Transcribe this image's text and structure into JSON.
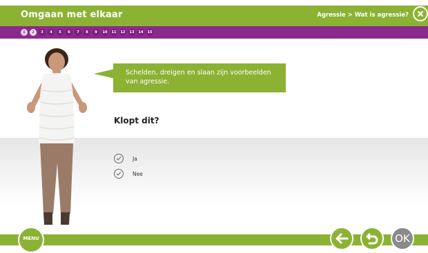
{
  "header": {
    "title": "Omgaan met elkaar",
    "breadcrumb": "Agressie > Wat is agressie?"
  },
  "progress": {
    "steps": [
      "1",
      "2",
      "3",
      "4",
      "5",
      "6",
      "7",
      "8",
      "9",
      "10",
      "11",
      "12",
      "13",
      "14",
      "15"
    ],
    "current_step": 2
  },
  "bubble": {
    "text": "Schelden, dreigen en slaan zijn voorbeelden van agressie."
  },
  "question": {
    "text": "Klopt dit?",
    "options": [
      {
        "label": "Ja"
      },
      {
        "label": "Nee"
      }
    ]
  },
  "footer": {
    "menu_label": "MENU",
    "ok_label": "OK"
  },
  "colors": {
    "green": "#8cb234",
    "purple": "#8a2a8c",
    "grey_button": "#8a8a8a"
  },
  "icons": [
    "close-icon",
    "check-icon",
    "back-arrow-icon",
    "retry-icon"
  ]
}
